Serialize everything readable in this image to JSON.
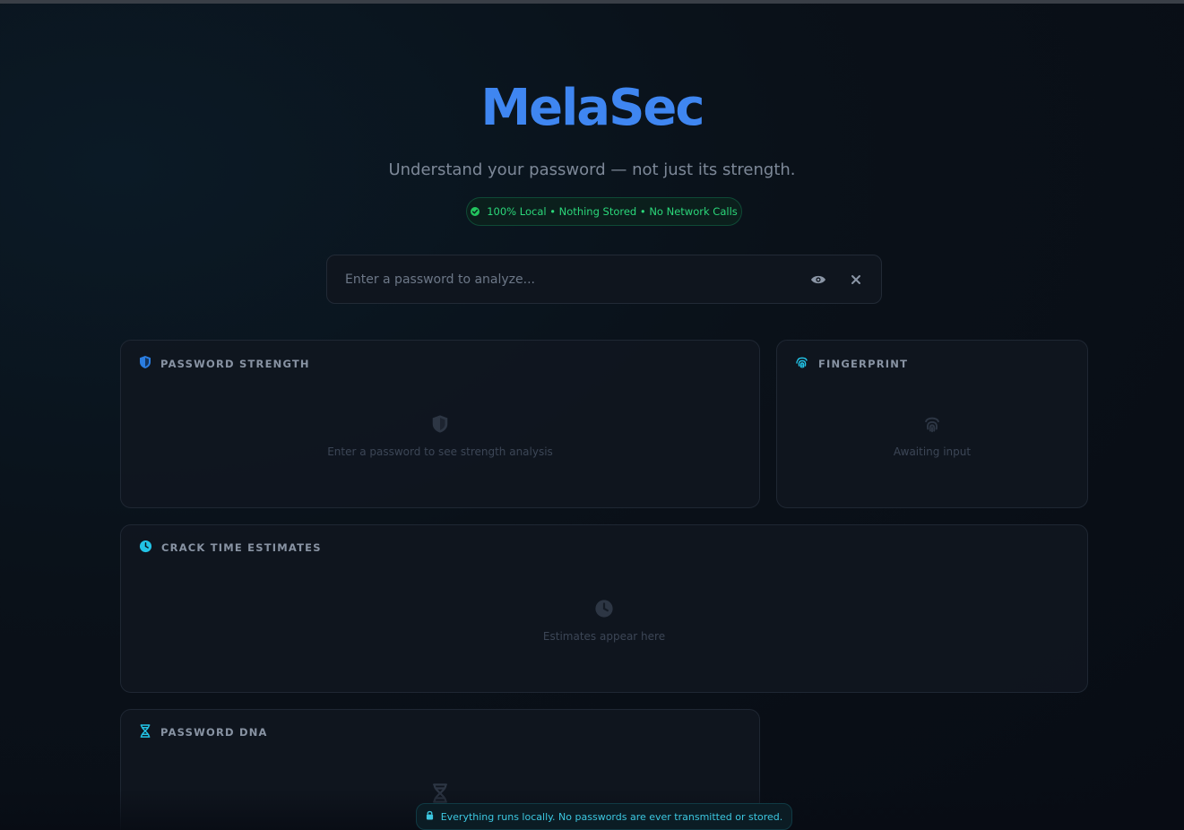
{
  "brand": {
    "logo": "MelaSec",
    "tagline": "Understand your password — not just its strength."
  },
  "badge": {
    "text": "100% Local • Nothing Stored • No Network Calls",
    "icon": "check-circle-icon"
  },
  "search": {
    "placeholder": "Enter a password to analyze...",
    "value": "",
    "toggle_icon": "eye-icon",
    "clear_icon": "close-icon"
  },
  "cards": {
    "strength": {
      "title": "PASSWORD STRENGTH",
      "icon": "shield-icon",
      "empty": "Enter a password to see strength analysis"
    },
    "fingerprint": {
      "title": "FINGERPRINT",
      "icon": "fingerprint-icon",
      "empty": "Awaiting input"
    },
    "crack": {
      "title": "CRACK TIME ESTIMATES",
      "icon": "clock-icon",
      "empty": "Estimates appear here"
    },
    "dna": {
      "title": "PASSWORD DNA",
      "icon": "dna-icon"
    }
  },
  "footer": {
    "text": "Everything runs locally. No passwords are ever transmitted or stored.",
    "icon": "lock-icon"
  },
  "colors": {
    "accent": "#3f86f1",
    "cyan": "#22c3e6",
    "success": "#2bd77a"
  }
}
